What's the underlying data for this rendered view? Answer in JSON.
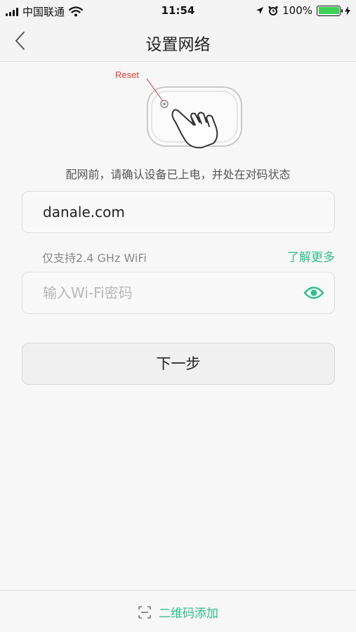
{
  "status_bar": {
    "carrier": "中国联通",
    "time": "11:54",
    "battery": "100%",
    "battery_level": 1.0
  },
  "nav": {
    "title": "设置网络",
    "back_icon": "chevron-left-icon"
  },
  "illustration": {
    "reset_label": "Reset",
    "reset_color": "#e53935"
  },
  "hint": "配网前，请确认设备已上电，并处在对码状态",
  "ssid": {
    "value": "danale.com"
  },
  "support": {
    "text": "仅支持2.4 GHz WiFi",
    "learn_more": "了解更多"
  },
  "password": {
    "placeholder": "输入Wi-Fi密码",
    "toggle_icon": "eye-icon"
  },
  "next_button": "下一步",
  "bottom": {
    "qr_label": "二维码添加",
    "qr_icon": "scan-icon"
  },
  "colors": {
    "accent": "#2fbf8c"
  }
}
